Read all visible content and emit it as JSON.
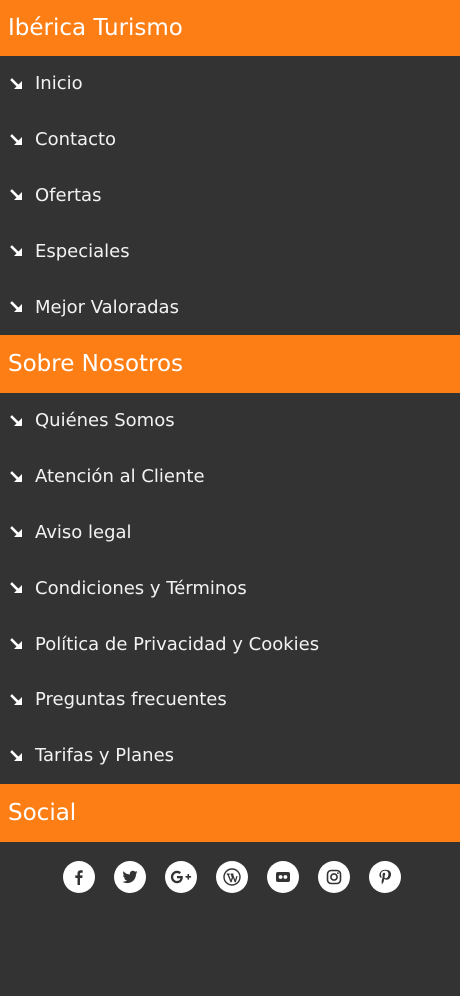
{
  "colors": {
    "accent": "#fd7e14",
    "background": "#333333",
    "text": "#f2f2f2",
    "icon_glyph": "#333333"
  },
  "sections": [
    {
      "title": "Ibérica Turismo",
      "items": [
        {
          "label": "Inicio",
          "icon": "arrow-down-right-icon"
        },
        {
          "label": "Contacto",
          "icon": "arrow-down-right-icon"
        },
        {
          "label": "Ofertas",
          "icon": "arrow-down-right-icon"
        },
        {
          "label": "Especiales",
          "icon": "arrow-down-right-icon"
        },
        {
          "label": "Mejor Valoradas",
          "icon": "arrow-down-right-icon"
        }
      ]
    },
    {
      "title": "Sobre Nosotros",
      "items": [
        {
          "label": "Quiénes Somos",
          "icon": "arrow-down-right-icon"
        },
        {
          "label": "Atención al Cliente",
          "icon": "arrow-down-right-icon"
        },
        {
          "label": "Aviso legal",
          "icon": "arrow-down-right-icon"
        },
        {
          "label": "Condiciones y Términos",
          "icon": "arrow-down-right-icon"
        },
        {
          "label": "Política de Privacidad y Cookies",
          "icon": "arrow-down-right-icon"
        },
        {
          "label": "Preguntas frecuentes",
          "icon": "arrow-down-right-icon"
        },
        {
          "label": "Tarifas y Planes",
          "icon": "arrow-down-right-icon"
        }
      ]
    },
    {
      "title": "Social",
      "social_icons": [
        "facebook-icon",
        "twitter-icon",
        "google-plus-icon",
        "wordpress-icon",
        "flickr-icon",
        "instagram-icon",
        "pinterest-icon"
      ]
    }
  ]
}
